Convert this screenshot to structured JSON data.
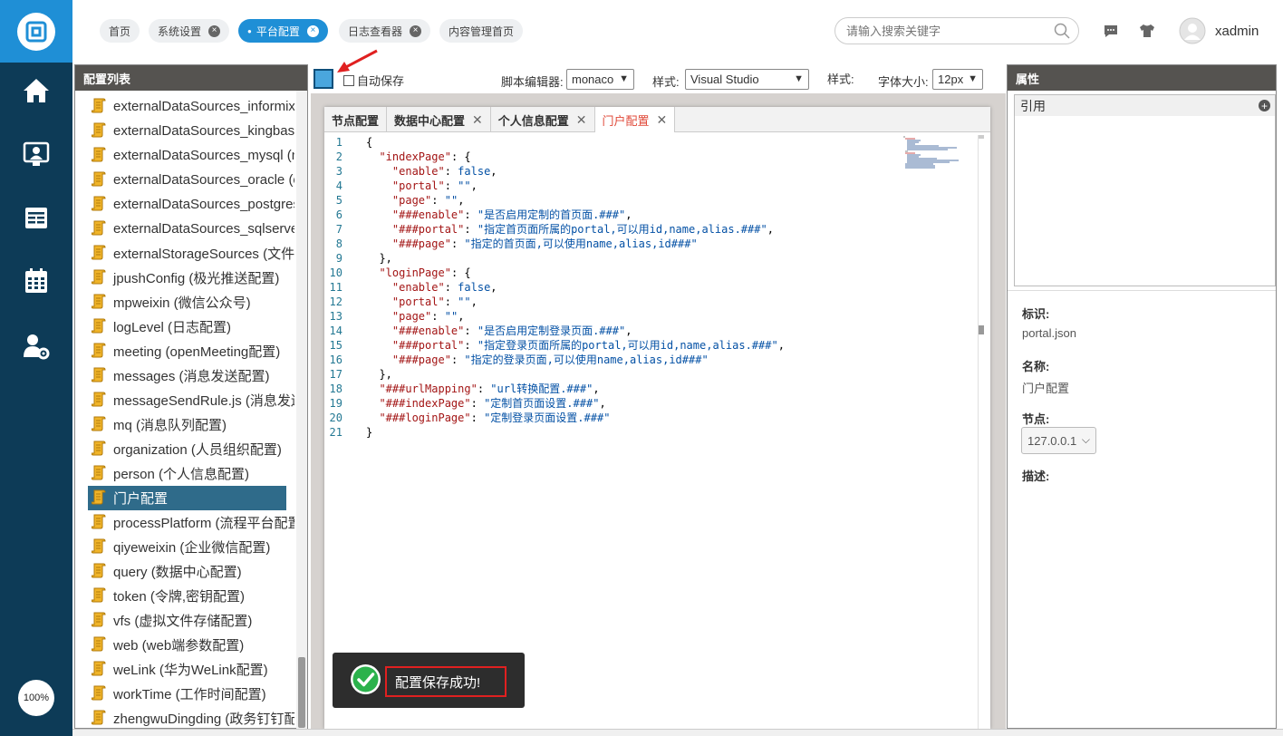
{
  "topbar": {
    "tabs": [
      {
        "label": "首页",
        "closable": false,
        "active": false
      },
      {
        "label": "系统设置",
        "closable": true,
        "active": false
      },
      {
        "label": "平台配置",
        "closable": true,
        "active": true
      },
      {
        "label": "日志查看器",
        "closable": true,
        "active": false
      },
      {
        "label": "内容管理首页",
        "closable": true,
        "active": false
      }
    ],
    "search_placeholder": "请输入搜索关键字",
    "user_name": "xadmin"
  },
  "leftnav": {
    "zoom_label": "100%",
    "icons": [
      "home-icon",
      "contact-icon",
      "report-icon",
      "calendar-icon",
      "user-settings-icon"
    ]
  },
  "config_list": {
    "title": "配置列表",
    "items": [
      "externalDataSources_informix",
      "externalDataSources_kingbase",
      "externalDataSources_mysql (m",
      "externalDataSources_oracle (o",
      "externalDataSources_postgres",
      "externalDataSources_sqlserver",
      "externalStorageSources (文件存",
      "jpushConfig (极光推送配置)",
      "mpweixin (微信公众号)",
      "logLevel (日志配置)",
      "meeting (openMeeting配置)",
      "messages (消息发送配置)",
      "messageSendRule.js (消息发送",
      "mq (消息队列配置)",
      "organization (人员组织配置)",
      "person (个人信息配置)",
      "门户配置",
      "processPlatform (流程平台配置",
      "qiyeweixin (企业微信配置)",
      "query (数据中心配置)",
      "token (令牌,密钥配置)",
      "vfs (虚拟文件存储配置)",
      "web (web端参数配置)",
      "weLink (华为WeLink配置)",
      "workTime (工作时间配置)",
      "zhengwuDingding (政务钉钉配"
    ],
    "selected_index": 16
  },
  "toolbar": {
    "autosave_label": "自动保存",
    "script_editor_label": "脚本编辑器:",
    "script_editor_value": "monaco",
    "style_label": "样式:",
    "style_value": "Visual Studio",
    "style2_label": "样式:",
    "font_size_label": "字体大小:",
    "font_size_value": "12px"
  },
  "editor": {
    "tabs": [
      {
        "label": "节点配置",
        "closable": false,
        "active": false
      },
      {
        "label": "数据中心配置",
        "closable": true,
        "active": false
      },
      {
        "label": "个人信息配置",
        "closable": true,
        "active": false
      },
      {
        "label": "门户配置",
        "closable": true,
        "active": true
      }
    ],
    "lines": [
      "{",
      "  \"indexPage\": {",
      "    \"enable\": false,",
      "    \"portal\": \"\",",
      "    \"page\": \"\",",
      "    \"###enable\": \"是否启用定制的首页面.###\",",
      "    \"###portal\": \"指定首页面所属的portal,可以用id,name,alias.###\",",
      "    \"###page\": \"指定的首页面,可以使用name,alias,id###\"",
      "  },",
      "  \"loginPage\": {",
      "    \"enable\": false,",
      "    \"portal\": \"\",",
      "    \"page\": \"\",",
      "    \"###enable\": \"是否启用定制登录页面.###\",",
      "    \"###portal\": \"指定登录页面所属的portal,可以用id,name,alias.###\",",
      "    \"###page\": \"指定的登录页面,可以使用name,alias,id###\"",
      "  },",
      "  \"###urlMapping\": \"url转换配置.###\",",
      "  \"###indexPage\": \"定制首页面设置.###\",",
      "  \"###loginPage\": \"定制登录页面设置.###\"",
      "}"
    ]
  },
  "toast": {
    "message": "配置保存成功!"
  },
  "properties": {
    "title": "属性",
    "ref_label": "引用",
    "id_label": "标识:",
    "id_value": "portal.json",
    "name_label": "名称:",
    "name_value": "门户配置",
    "node_label": "节点:",
    "node_value": "127.0.0.1",
    "desc_label": "描述:"
  },
  "colors": {
    "nav_bg": "#0d3b57",
    "brand_blue": "#1f8fd6",
    "panel_head": "#555350",
    "selected_row": "#2f6b8a",
    "annotation_red": "#e02020"
  }
}
